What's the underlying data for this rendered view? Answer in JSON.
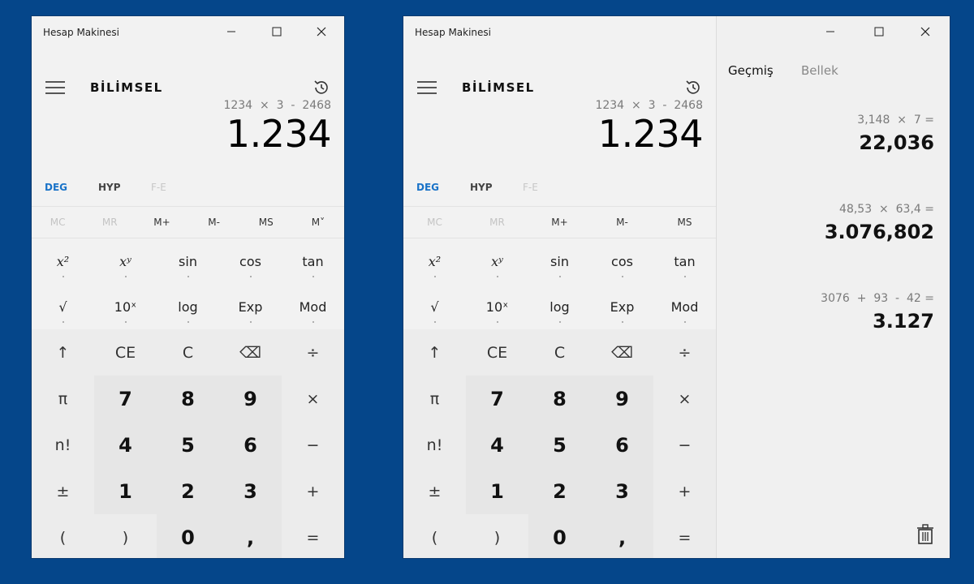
{
  "app_title": "Hesap Makinesi",
  "mode_title": "BİLİMSEL",
  "expression": "1234  ×  3  -  2468",
  "display_value": "1.234",
  "angle_modes": {
    "deg": "DEG",
    "hyp": "HYP",
    "fe": "F-E"
  },
  "memory_keys": [
    "MC",
    "MR",
    "M+",
    "M-",
    "MS",
    "M˅"
  ],
  "memory_keys_win2": [
    "MC",
    "MR",
    "M+",
    "M-",
    "MS"
  ],
  "sci_row1": [
    "x²",
    "xʸ",
    "sin",
    "cos",
    "tan"
  ],
  "sci_row2": [
    "√",
    "10ˣ",
    "log",
    "Exp",
    "Mod"
  ],
  "op_row": [
    "↑",
    "CE",
    "C",
    "⌫",
    "÷"
  ],
  "num_rows": [
    [
      "π",
      "7",
      "8",
      "9",
      "×"
    ],
    [
      "n!",
      "4",
      "5",
      "6",
      "−"
    ],
    [
      "±",
      "1",
      "2",
      "3",
      "+"
    ],
    [
      "(",
      ")",
      "0",
      ",",
      "="
    ]
  ],
  "panel": {
    "tab_history": "Geçmiş",
    "tab_memory": "Bellek",
    "history": [
      {
        "expression": "3,148  ×  7 =",
        "result": "22,036"
      },
      {
        "expression": "48,53  ×  63,4 =",
        "result": "3.076,802"
      },
      {
        "expression": "3076  +  93  -  42 =",
        "result": "3.127"
      }
    ]
  },
  "icons": {
    "minimize": "minimize-icon",
    "maximize": "maximize-icon",
    "close": "close-icon",
    "menu": "hamburger-icon",
    "history": "history-icon",
    "backspace": "backspace-icon",
    "trash": "trash-icon"
  },
  "colors": {
    "background": "#05468a",
    "accent": "#1a73c8",
    "window": "#f2f2f2"
  }
}
